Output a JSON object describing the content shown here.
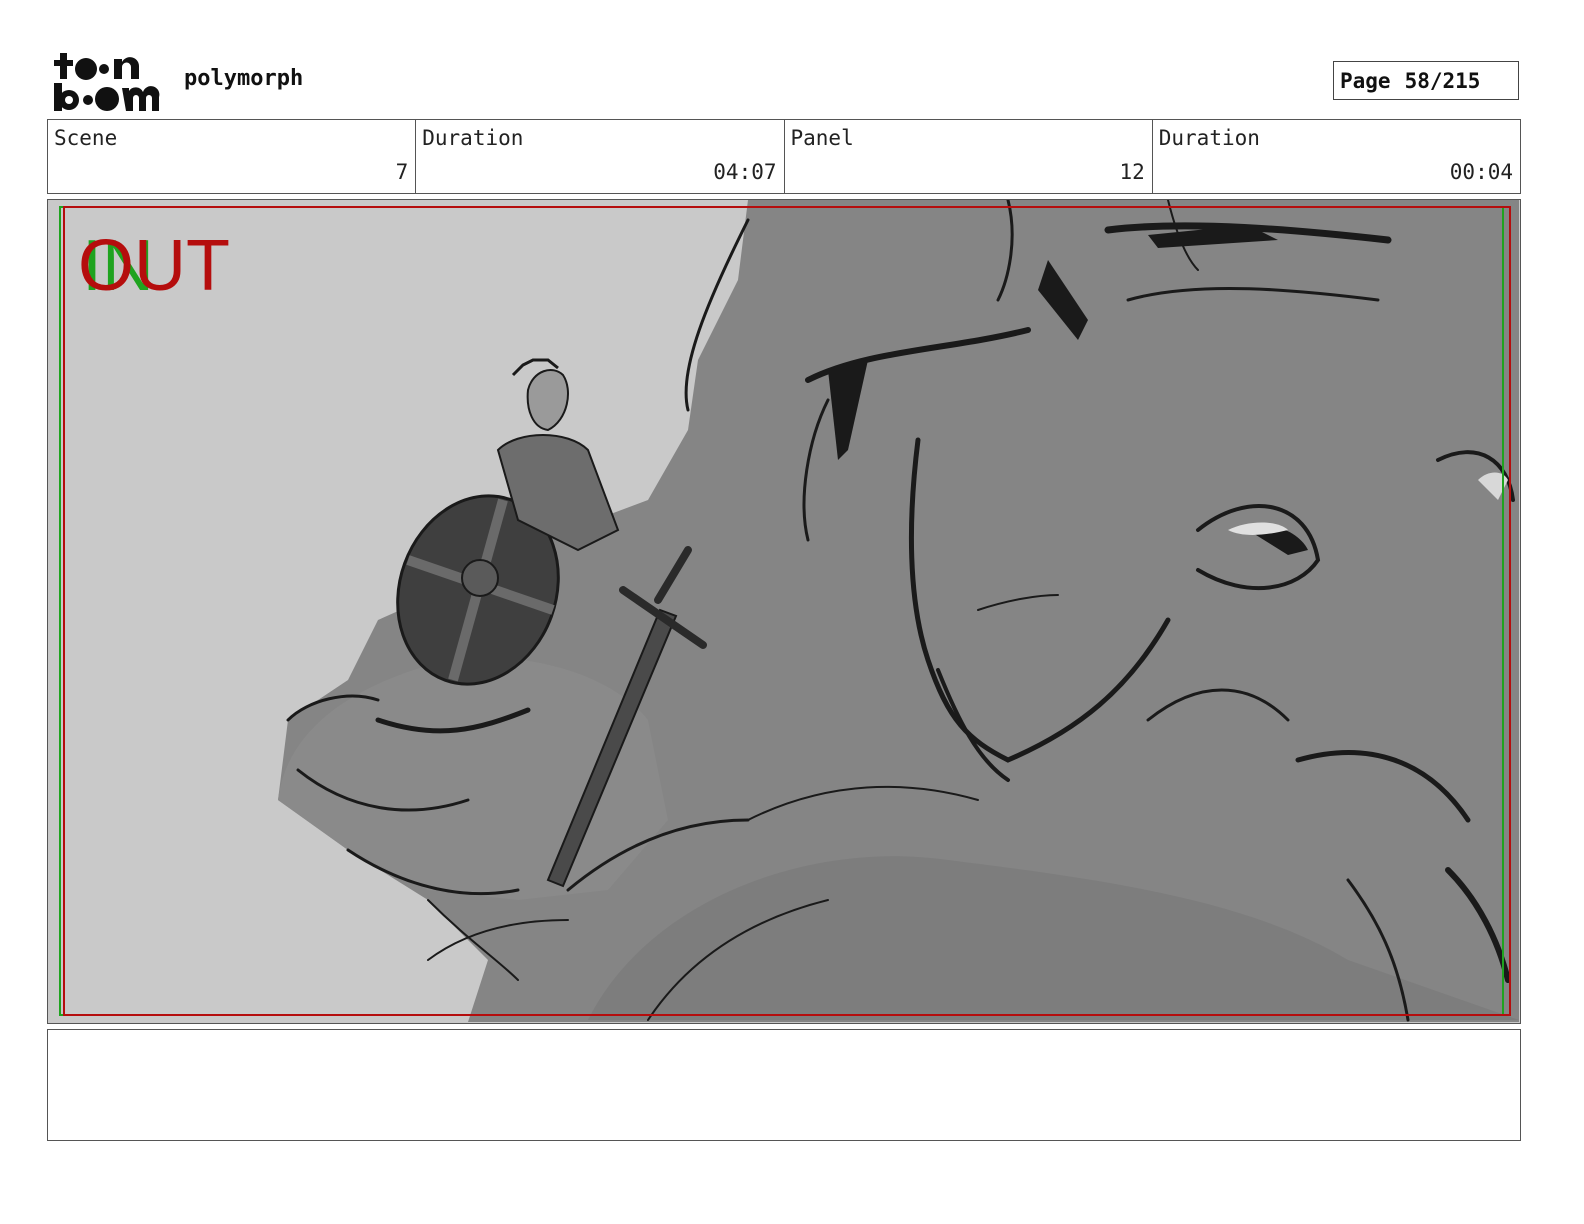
{
  "header": {
    "logo_text": "toon boom",
    "project_title": "polymorph",
    "page_label": "Page",
    "page_value": "58/215"
  },
  "info": {
    "scene_label": "Scene",
    "scene_value": "7",
    "scene_duration_label": "Duration",
    "scene_duration_value": "04:07",
    "panel_label": "Panel",
    "panel_value": "12",
    "panel_duration_label": "Duration",
    "panel_duration_value": "00:04"
  },
  "panel": {
    "in_marker": "IN",
    "out_marker": "OUT",
    "safe_frame_colors": {
      "in": "#1fa31f",
      "out": "#b50d0d"
    }
  },
  "notes": {
    "text": ""
  }
}
